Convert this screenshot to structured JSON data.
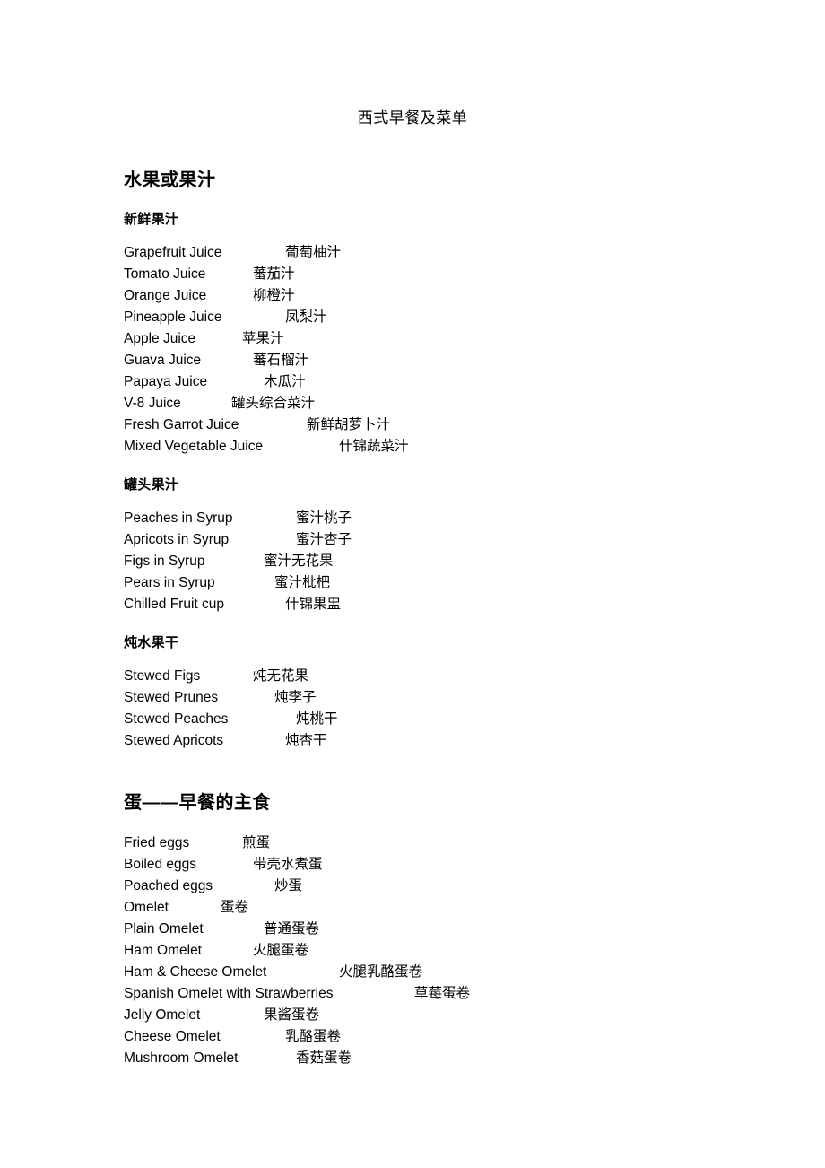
{
  "document": {
    "title": "西式早餐及菜单",
    "sections": [
      {
        "heading": "水果或果汁",
        "heading_level": 1,
        "subsections": [
          {
            "heading": "新鲜果汁",
            "heading_level": 2,
            "items": [
              {
                "en": "Grapefruit Juice",
                "cn": "葡萄柚汁",
                "tab": 180
              },
              {
                "en": "Tomato Juice",
                "cn": "蕃茄汁",
                "tab": 144
              },
              {
                "en": "Orange Juice",
                "cn": "柳橙汁",
                "tab": 144
              },
              {
                "en": "Pineapple Juice",
                "cn": "凤梨汁",
                "tab": 180
              },
              {
                "en": "Apple Juice",
                "cn": "苹果汁",
                "tab": 132
              },
              {
                "en": "Guava Juice",
                "cn": "蕃石榴汁",
                "tab": 144
              },
              {
                "en": "Papaya Juice",
                "cn": "木瓜汁",
                "tab": 156
              },
              {
                "en": "V-8 Juice",
                "cn": "罐头综合菜汁",
                "tab": 120
              },
              {
                "en": "Fresh Garrot Juice",
                "cn": "新鲜胡萝卜汁",
                "tab": 204
              },
              {
                "en": "Mixed Vegetable Juice",
                "cn": "什锦蔬菜汁",
                "tab": 240
              }
            ]
          },
          {
            "heading": "罐头果汁",
            "heading_level": 2,
            "items": [
              {
                "en": "Peaches in Syrup",
                "cn": "蜜汁桃子",
                "tab": 192
              },
              {
                "en": "Apricots in Syrup",
                "cn": "蜜汁杏子",
                "tab": 192
              },
              {
                "en": "Figs in Syrup",
                "cn": "蜜汁无花果",
                "tab": 156
              },
              {
                "en": "Pears in Syrup",
                "cn": "蜜汁枇杷",
                "tab": 168
              },
              {
                "en": "Chilled Fruit cup",
                "cn": "什锦果盅",
                "tab": 180
              }
            ]
          },
          {
            "heading": "炖水果干",
            "heading_level": 2,
            "items": [
              {
                "en": "Stewed Figs",
                "cn": "炖无花果",
                "tab": 144
              },
              {
                "en": "Stewed Prunes",
                "cn": "炖李子",
                "tab": 168
              },
              {
                "en": "Stewed Peaches",
                "cn": "炖桃干",
                "tab": 192
              },
              {
                "en": "Stewed Apricots",
                "cn": "炖杏干",
                "tab": 180
              }
            ]
          }
        ]
      },
      {
        "heading": "蛋——早餐的主食",
        "heading_level": 1,
        "subsections": [
          {
            "heading": "",
            "heading_level": 0,
            "items": [
              {
                "en": "Fried eggs",
                "cn": "煎蛋",
                "tab": 132
              },
              {
                "en": "Boiled eggs",
                "cn": "带壳水煮蛋",
                "tab": 144
              },
              {
                "en": "Poached eggs",
                "cn": "炒蛋",
                "tab": 168
              },
              {
                "en": "Omelet",
                "cn": "蛋卷",
                "tab": 108
              },
              {
                "en": "Plain Omelet",
                "cn": "普通蛋卷",
                "tab": 156
              },
              {
                "en": "Ham Omelet",
                "cn": "火腿蛋卷",
                "tab": 144
              },
              {
                "en": "Ham & Cheese Omelet",
                "cn": "火腿乳酪蛋卷",
                "tab": 240
              },
              {
                "en": "Spanish Omelet with Strawberries",
                "cn": "草莓蛋卷",
                "tab": 324
              },
              {
                "en": "Jelly Omelet",
                "cn": "果酱蛋卷",
                "tab": 156
              },
              {
                "en": "Cheese Omelet",
                "cn": "乳酪蛋卷",
                "tab": 180
              },
              {
                "en": "Mushroom Omelet",
                "cn": "香菇蛋卷",
                "tab": 192
              }
            ]
          }
        ]
      }
    ]
  }
}
